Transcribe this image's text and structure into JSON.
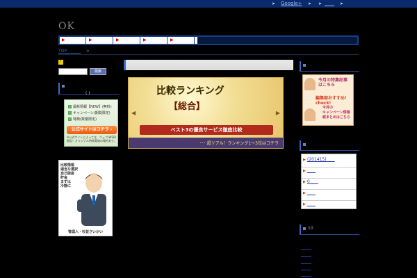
{
  "topbar": {
    "links": [
      "Google+",
      "",
      "____"
    ]
  },
  "logo": "OK",
  "nav": {
    "items": [
      "▶",
      "▶",
      "▶",
      "▶",
      "▶"
    ]
  },
  "breadcrumb": {
    "home": "TOP ______",
    "sep": ">"
  },
  "left": {
    "rss": "!",
    "search_button": "検索",
    "section_sub": "　　　　　( )",
    "promo": {
      "lines": [
        "最新情報【NEW】(無料)",
        "キャンペーン(期間限定)",
        "特典(数量限定)"
      ],
      "button": "公式サイトはコチラ ›",
      "note": "※公式サイトによっては、ウェブ(WEB)限定！オリジナル特典実施の場合あり。"
    },
    "manager": {
      "speech": "比較情報　\n適当な選択\n自己破産\n貯金\nまずは\n冷静に",
      "caption": "管理人・杉並さいかい"
    }
  },
  "banner": {
    "title1": "比較ランキング",
    "title2": "【総合】",
    "ribbon": "ベスト3の優良サービス徹底比較",
    "footer": "･･･ 超リアル！ランキング1〜3位はコチラ"
  },
  "right": {
    "feature": {
      "line1": "今月の特集記事\nはこちら",
      "line2": "編集部おすすめ！ check!",
      "line3": "今月の\nキャンペーン情報\n総まとめはこちら"
    },
    "list_items": [
      "(201415)____",
      "____",
      "0____",
      "____",
      "____"
    ],
    "section3": "10",
    "low_links": [
      "______",
      "______",
      "______",
      "______",
      "______"
    ]
  }
}
